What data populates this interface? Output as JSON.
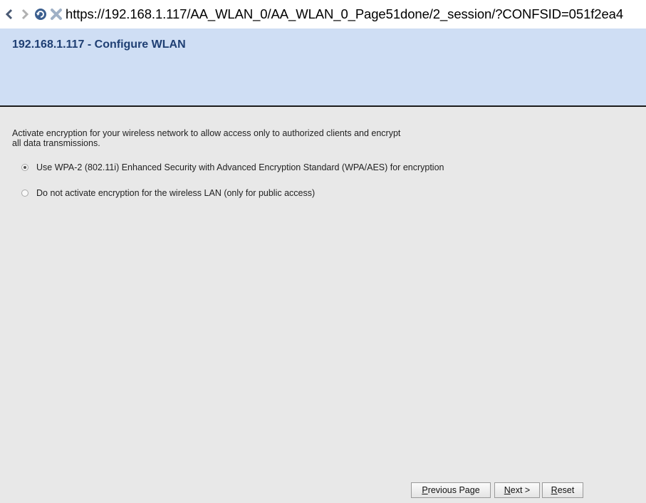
{
  "toolbar": {
    "back_icon": "chevron-left-icon",
    "forward_icon": "chevron-right-icon",
    "reload_icon": "reload-icon",
    "stop_icon": "stop-icon",
    "url": "https://192.168.1.117/AA_WLAN_0/AA_WLAN_0_Page51done/2_session/?CONFSID=051f2ea4"
  },
  "header": {
    "title": "192.168.1.117 - Configure WLAN",
    "background": "#cfdef4",
    "title_color": "#1f3f73"
  },
  "content": {
    "intro": "Activate encryption for your wireless network to allow access only to authorized clients and encrypt all data transmissions.",
    "options": [
      {
        "label": "Use WPA-2 (802.11i) Enhanced Security with Advanced Encryption Standard (WPA/AES) for encryption",
        "selected": true
      },
      {
        "label": "Do not activate encryption for the wireless LAN (only for public access)",
        "selected": false
      }
    ]
  },
  "buttons": {
    "previous": {
      "label": "Previous Page",
      "accesskey": "P"
    },
    "next": {
      "label": "Next >",
      "accesskey": "N"
    },
    "reset": {
      "label": "Reset",
      "accesskey": "R"
    }
  }
}
